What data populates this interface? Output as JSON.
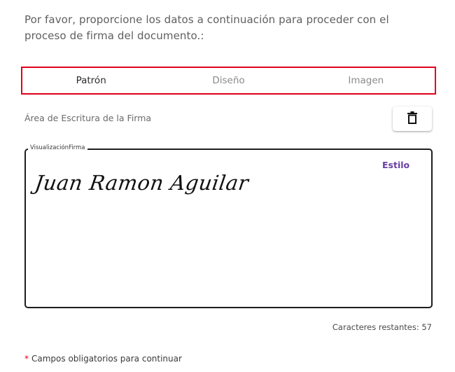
{
  "intro": {
    "text": "Por favor, proporcione los datos a continuación para proceder con el proceso de firma del documento.:"
  },
  "tabs": [
    {
      "label": "Patrón",
      "active": true
    },
    {
      "label": "Diseño",
      "active": false
    },
    {
      "label": "Imagen",
      "active": false
    }
  ],
  "signature_area": {
    "label": "Área de Escritura de la Firma",
    "clear_icon": "trash-icon",
    "fieldset_legend": "VisualizaciónFirma",
    "style_link": "Estilo",
    "signature_text": "Juan Ramon Aguilar"
  },
  "footer": {
    "remaining": "Caracteres restantes: 57",
    "required_mark": "*",
    "required_text": "Campos obligatorios para continuar"
  },
  "colors": {
    "tab_border": "#e0001b",
    "style_link": "#6a3ea1",
    "required_mark": "#e0001b"
  }
}
